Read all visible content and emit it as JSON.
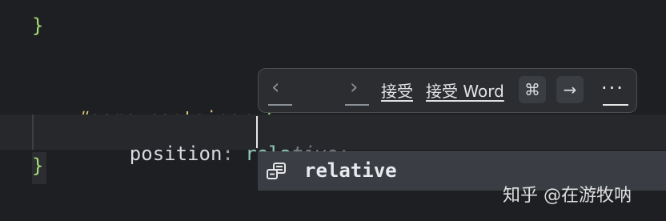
{
  "editor": {
    "lines": {
      "closing_brace_1": "}",
      "selector": "#game-container",
      "open_brace": "{",
      "property": "position",
      "colon": ":",
      "typed_value": "rela",
      "ghost_suggestion": "tive;",
      "closing_brace_2": "}"
    }
  },
  "inline_toolbar": {
    "prev_icon": "chevron-left-icon",
    "next_icon": "chevron-right-icon",
    "accept_label": "接受",
    "accept_word_label": "接受 Word",
    "cmd_key": "⌘",
    "arrow_key": "→",
    "more_label": "···"
  },
  "completion_popup": {
    "items": [
      {
        "icon": "css-property-value-icon",
        "label": "relative"
      }
    ]
  },
  "watermark": {
    "text": "知乎 @在游牧呐"
  },
  "colors": {
    "background": "#1e1f22",
    "brace": "#a9dc76",
    "selector": "#d5c27b",
    "value": "#8ecbb2",
    "ghost": "#7b7f87"
  }
}
